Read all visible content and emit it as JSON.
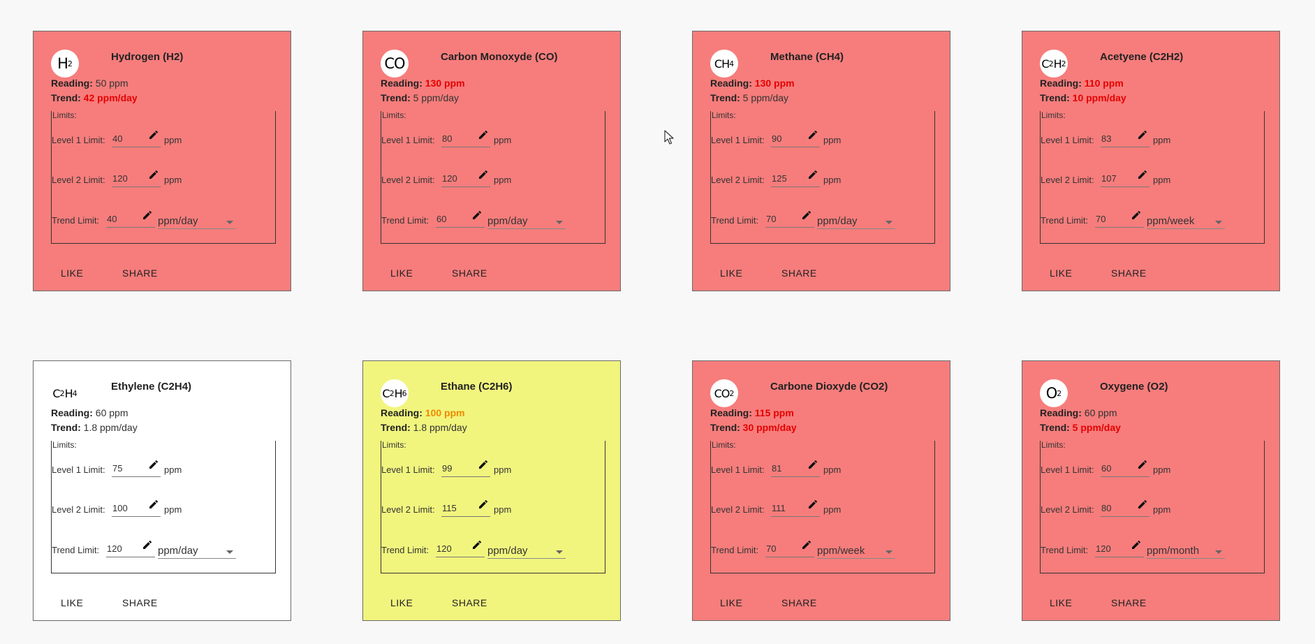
{
  "colors": {
    "alarm_card": "#f67d7c",
    "warn_card": "#f1f57e",
    "ok_card": "#ffffff",
    "alarm_text": "#e50000",
    "warn_text": "#f08a00"
  },
  "labels": {
    "reading": "Reading:",
    "trend": "Trend:",
    "limits": "Limits:",
    "level1": "Level 1 Limit:",
    "level2": "Level 2 Limit:",
    "trend_limit": "Trend Limit:",
    "ppm": "ppm",
    "like": "LIKE",
    "share": "SHARE"
  },
  "cards": [
    {
      "title": "Hydrogen (H2)",
      "logo_main": "H",
      "logo_sub": "2",
      "logo2_main": "",
      "logo2_sub": "",
      "status": "alarm",
      "reading": "50 ppm",
      "reading_status": "normal",
      "trend": "42 ppm/day",
      "trend_status": "alarm",
      "level1": "40",
      "level2": "120",
      "trend_limit": "40",
      "trend_unit": "ppm/day"
    },
    {
      "title": "Carbon Monoxyde (CO)",
      "logo_main": "CO",
      "logo_sub": "",
      "logo2_main": "",
      "logo2_sub": "",
      "status": "alarm",
      "reading": "130 ppm",
      "reading_status": "alarm",
      "trend": "5 ppm/day",
      "trend_status": "normal",
      "level1": "80",
      "level2": "120",
      "trend_limit": "60",
      "trend_unit": "ppm/day"
    },
    {
      "title": "Methane (CH4)",
      "logo_main": "CH",
      "logo_sub": "4",
      "logo2_main": "",
      "logo2_sub": "",
      "status": "alarm",
      "reading": "130 ppm",
      "reading_status": "alarm",
      "trend": "5 ppm/day",
      "trend_status": "normal",
      "level1": "90",
      "level2": "125",
      "trend_limit": "70",
      "trend_unit": "ppm/day"
    },
    {
      "title": "Acetyene (C2H2)",
      "logo_main": "C",
      "logo_sub": "2",
      "logo2_main": "H",
      "logo2_sub": "2",
      "status": "alarm",
      "reading": "110 ppm",
      "reading_status": "alarm",
      "trend": "10 ppm/day",
      "trend_status": "alarm",
      "level1": "83",
      "level2": "107",
      "trend_limit": "70",
      "trend_unit": "ppm/week"
    },
    {
      "title": "Ethylene (C2H4)",
      "logo_main": "C",
      "logo_sub": "2",
      "logo2_main": "H",
      "logo2_sub": "4",
      "status": "ok",
      "reading": "60 ppm",
      "reading_status": "normal",
      "trend": "1.8 ppm/day",
      "trend_status": "normal",
      "level1": "75",
      "level2": "100",
      "trend_limit": "120",
      "trend_unit": "ppm/day"
    },
    {
      "title": "Ethane (C2H6)",
      "logo_main": "C",
      "logo_sub": "2",
      "logo2_main": "H",
      "logo2_sub": "6",
      "status": "warn",
      "reading": "100 ppm",
      "reading_status": "warn",
      "trend": "1.8 ppm/day",
      "trend_status": "normal",
      "level1": "99",
      "level2": "115",
      "trend_limit": "120",
      "trend_unit": "ppm/day"
    },
    {
      "title": "Carbone Dioxyde (CO2)",
      "logo_main": "CO",
      "logo_sub": "2",
      "logo2_main": "",
      "logo2_sub": "",
      "status": "alarm",
      "reading": "115 ppm",
      "reading_status": "alarm",
      "trend": "30 ppm/day",
      "trend_status": "alarm",
      "level1": "81",
      "level2": "111",
      "trend_limit": "70",
      "trend_unit": "ppm/week"
    },
    {
      "title": "Oxygene (O2)",
      "logo_main": "O",
      "logo_sub": "2",
      "logo2_main": "",
      "logo2_sub": "",
      "status": "alarm",
      "reading": "60 ppm",
      "reading_status": "normal",
      "trend": "5 ppm/day",
      "trend_status": "alarm",
      "level1": "60",
      "level2": "80",
      "trend_limit": "120",
      "trend_unit": "ppm/month"
    }
  ]
}
